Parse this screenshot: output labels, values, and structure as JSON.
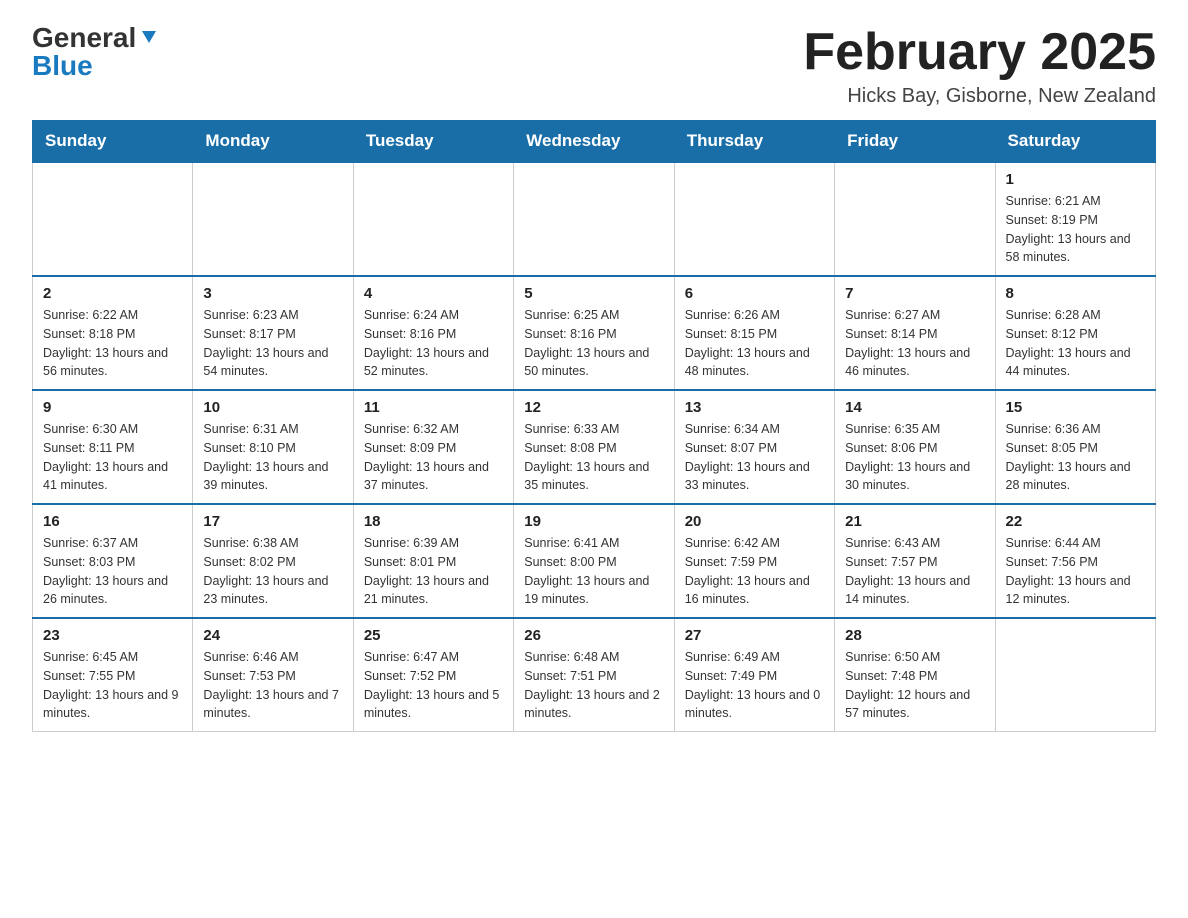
{
  "header": {
    "logo_general": "General",
    "logo_blue": "Blue",
    "month_title": "February 2025",
    "location": "Hicks Bay, Gisborne, New Zealand"
  },
  "weekdays": [
    "Sunday",
    "Monday",
    "Tuesday",
    "Wednesday",
    "Thursday",
    "Friday",
    "Saturday"
  ],
  "weeks": [
    [
      {
        "day": "",
        "info": ""
      },
      {
        "day": "",
        "info": ""
      },
      {
        "day": "",
        "info": ""
      },
      {
        "day": "",
        "info": ""
      },
      {
        "day": "",
        "info": ""
      },
      {
        "day": "",
        "info": ""
      },
      {
        "day": "1",
        "info": "Sunrise: 6:21 AM\nSunset: 8:19 PM\nDaylight: 13 hours and 58 minutes."
      }
    ],
    [
      {
        "day": "2",
        "info": "Sunrise: 6:22 AM\nSunset: 8:18 PM\nDaylight: 13 hours and 56 minutes."
      },
      {
        "day": "3",
        "info": "Sunrise: 6:23 AM\nSunset: 8:17 PM\nDaylight: 13 hours and 54 minutes."
      },
      {
        "day": "4",
        "info": "Sunrise: 6:24 AM\nSunset: 8:16 PM\nDaylight: 13 hours and 52 minutes."
      },
      {
        "day": "5",
        "info": "Sunrise: 6:25 AM\nSunset: 8:16 PM\nDaylight: 13 hours and 50 minutes."
      },
      {
        "day": "6",
        "info": "Sunrise: 6:26 AM\nSunset: 8:15 PM\nDaylight: 13 hours and 48 minutes."
      },
      {
        "day": "7",
        "info": "Sunrise: 6:27 AM\nSunset: 8:14 PM\nDaylight: 13 hours and 46 minutes."
      },
      {
        "day": "8",
        "info": "Sunrise: 6:28 AM\nSunset: 8:12 PM\nDaylight: 13 hours and 44 minutes."
      }
    ],
    [
      {
        "day": "9",
        "info": "Sunrise: 6:30 AM\nSunset: 8:11 PM\nDaylight: 13 hours and 41 minutes."
      },
      {
        "day": "10",
        "info": "Sunrise: 6:31 AM\nSunset: 8:10 PM\nDaylight: 13 hours and 39 minutes."
      },
      {
        "day": "11",
        "info": "Sunrise: 6:32 AM\nSunset: 8:09 PM\nDaylight: 13 hours and 37 minutes."
      },
      {
        "day": "12",
        "info": "Sunrise: 6:33 AM\nSunset: 8:08 PM\nDaylight: 13 hours and 35 minutes."
      },
      {
        "day": "13",
        "info": "Sunrise: 6:34 AM\nSunset: 8:07 PM\nDaylight: 13 hours and 33 minutes."
      },
      {
        "day": "14",
        "info": "Sunrise: 6:35 AM\nSunset: 8:06 PM\nDaylight: 13 hours and 30 minutes."
      },
      {
        "day": "15",
        "info": "Sunrise: 6:36 AM\nSunset: 8:05 PM\nDaylight: 13 hours and 28 minutes."
      }
    ],
    [
      {
        "day": "16",
        "info": "Sunrise: 6:37 AM\nSunset: 8:03 PM\nDaylight: 13 hours and 26 minutes."
      },
      {
        "day": "17",
        "info": "Sunrise: 6:38 AM\nSunset: 8:02 PM\nDaylight: 13 hours and 23 minutes."
      },
      {
        "day": "18",
        "info": "Sunrise: 6:39 AM\nSunset: 8:01 PM\nDaylight: 13 hours and 21 minutes."
      },
      {
        "day": "19",
        "info": "Sunrise: 6:41 AM\nSunset: 8:00 PM\nDaylight: 13 hours and 19 minutes."
      },
      {
        "day": "20",
        "info": "Sunrise: 6:42 AM\nSunset: 7:59 PM\nDaylight: 13 hours and 16 minutes."
      },
      {
        "day": "21",
        "info": "Sunrise: 6:43 AM\nSunset: 7:57 PM\nDaylight: 13 hours and 14 minutes."
      },
      {
        "day": "22",
        "info": "Sunrise: 6:44 AM\nSunset: 7:56 PM\nDaylight: 13 hours and 12 minutes."
      }
    ],
    [
      {
        "day": "23",
        "info": "Sunrise: 6:45 AM\nSunset: 7:55 PM\nDaylight: 13 hours and 9 minutes."
      },
      {
        "day": "24",
        "info": "Sunrise: 6:46 AM\nSunset: 7:53 PM\nDaylight: 13 hours and 7 minutes."
      },
      {
        "day": "25",
        "info": "Sunrise: 6:47 AM\nSunset: 7:52 PM\nDaylight: 13 hours and 5 minutes."
      },
      {
        "day": "26",
        "info": "Sunrise: 6:48 AM\nSunset: 7:51 PM\nDaylight: 13 hours and 2 minutes."
      },
      {
        "day": "27",
        "info": "Sunrise: 6:49 AM\nSunset: 7:49 PM\nDaylight: 13 hours and 0 minutes."
      },
      {
        "day": "28",
        "info": "Sunrise: 6:50 AM\nSunset: 7:48 PM\nDaylight: 12 hours and 57 minutes."
      },
      {
        "day": "",
        "info": ""
      }
    ]
  ]
}
